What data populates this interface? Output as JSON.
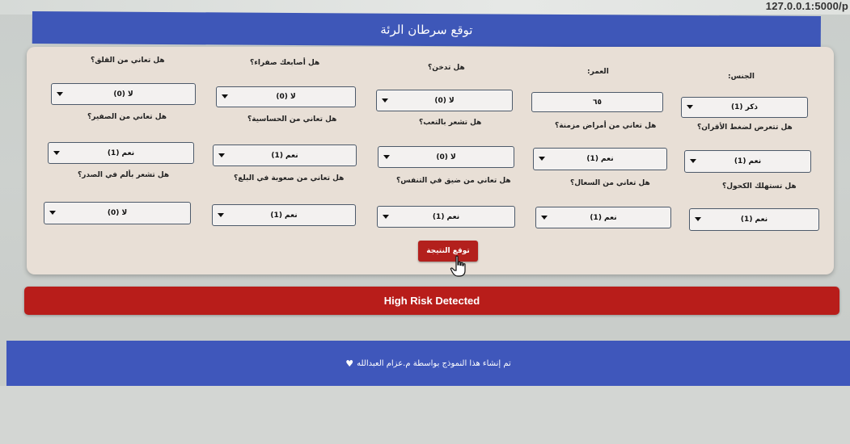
{
  "browser": {
    "url": "127.0.0.1:5000/p"
  },
  "header": {
    "title": "توقع سرطان الرئة"
  },
  "form": {
    "rows": [
      [
        {
          "label": "الجنس:",
          "value": "ذكر (1)"
        },
        {
          "label": "العمر:",
          "value": "٦٥"
        },
        {
          "label": "هل تدخن؟",
          "value": "لا (0)"
        },
        {
          "label": "هل أصابعك صفراء؟",
          "value": "لا (0)"
        },
        {
          "label": "هل تعاني من القلق؟",
          "value": "لا (0)"
        }
      ],
      [
        {
          "label": "هل تتعرض لضغط الأقران؟",
          "value": "نعم (1)"
        },
        {
          "label": "هل تعاني من أمراض مزمنة؟",
          "value": "نعم (1)"
        },
        {
          "label": "هل تشعر بالتعب؟",
          "value": "لا (0)"
        },
        {
          "label": "هل تعاني من الحساسية؟",
          "value": "نعم (1)"
        },
        {
          "label": "هل تعاني من الصفير؟",
          "value": "نعم (1)"
        }
      ],
      [
        {
          "label": "هل تستهلك الكحول؟",
          "value": "نعم (1)"
        },
        {
          "label": "هل تعاني من السعال؟",
          "value": "نعم (1)"
        },
        {
          "label": "هل تعاني من ضيق في التنفس؟",
          "value": "نعم (1)"
        },
        {
          "label": "هل تعاني من صعوبة في البلع؟",
          "value": "نعم (1)"
        },
        {
          "label": "هل تشعر بألم في الصدر؟",
          "value": "لا (0)"
        }
      ]
    ],
    "submit_label": "توقع النتيجة"
  },
  "result": {
    "text": "High Risk Detected",
    "color": "#b81d1a"
  },
  "footer": {
    "text": "تم إنشاء هذا النموذج بواسطة م.عزام العبدالله",
    "icon": "heart-icon"
  },
  "colors": {
    "header_blue": "#3e57b8",
    "card_bg": "#e8dfd6",
    "button_red": "#b3201d"
  }
}
